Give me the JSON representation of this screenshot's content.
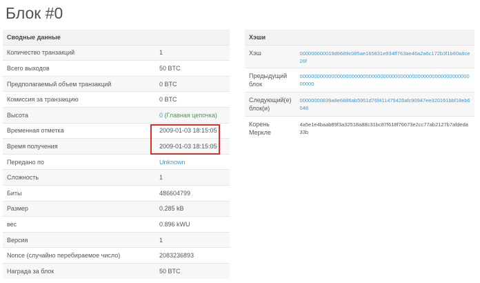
{
  "page": {
    "title": "Блок #0"
  },
  "summary": {
    "header": "Сводные данные",
    "rows": [
      {
        "label": "Количество транзакций",
        "value": "1"
      },
      {
        "label": "Всего выходов",
        "value": "50 BTC"
      },
      {
        "label": "Предполагаемый объем транзакций",
        "value": "0 BTC"
      },
      {
        "label": "Комиссия за транзакцию",
        "value": "0 BTC"
      },
      {
        "label": "Высота",
        "value": "0",
        "extra": "(Главная цепочка)"
      },
      {
        "label": "Временная отметка",
        "value": "2009-01-03 18:15:05"
      },
      {
        "label": "Время получения",
        "value": "2009-01-03 18:15:05"
      },
      {
        "label": "Передано по",
        "value": "Unknown"
      },
      {
        "label": "Сложность",
        "value": "1"
      },
      {
        "label": "Биты",
        "value": "486604799"
      },
      {
        "label": "Размер",
        "value": "0.285 kB"
      },
      {
        "label": "вес",
        "value": "0.896 kWU"
      },
      {
        "label": "Версия",
        "value": "1"
      },
      {
        "label": "Nonce (случайно перебираемое число)",
        "value": "2083236893"
      },
      {
        "label": "Награда за блок",
        "value": "50 BTC"
      }
    ]
  },
  "hashes": {
    "header": "Хэши",
    "rows": [
      {
        "label": "Хэш",
        "value": "000000000019d6689c085ae165831e934ff763ae46a2a6c172b3f1b60a8ce26f"
      },
      {
        "label": "Предыдущий блок",
        "value": "0000000000000000000000000000000000000000000000000000000000000000"
      },
      {
        "label": "Следующий(е) блок(и)",
        "value": "00000000839a8e6886ab5951d76f411475428afc90947ee320161bbf18eb6048"
      },
      {
        "label": "Корень Меркле",
        "value": "4a5e1e4baab89f3a32518a88c31bc87f618f76673e2cc77ab2127b7afdeda33b"
      }
    ]
  },
  "colors": {
    "link": "#3a98d4",
    "main_chain": "#43a047",
    "highlight_box": "#d0312d"
  }
}
